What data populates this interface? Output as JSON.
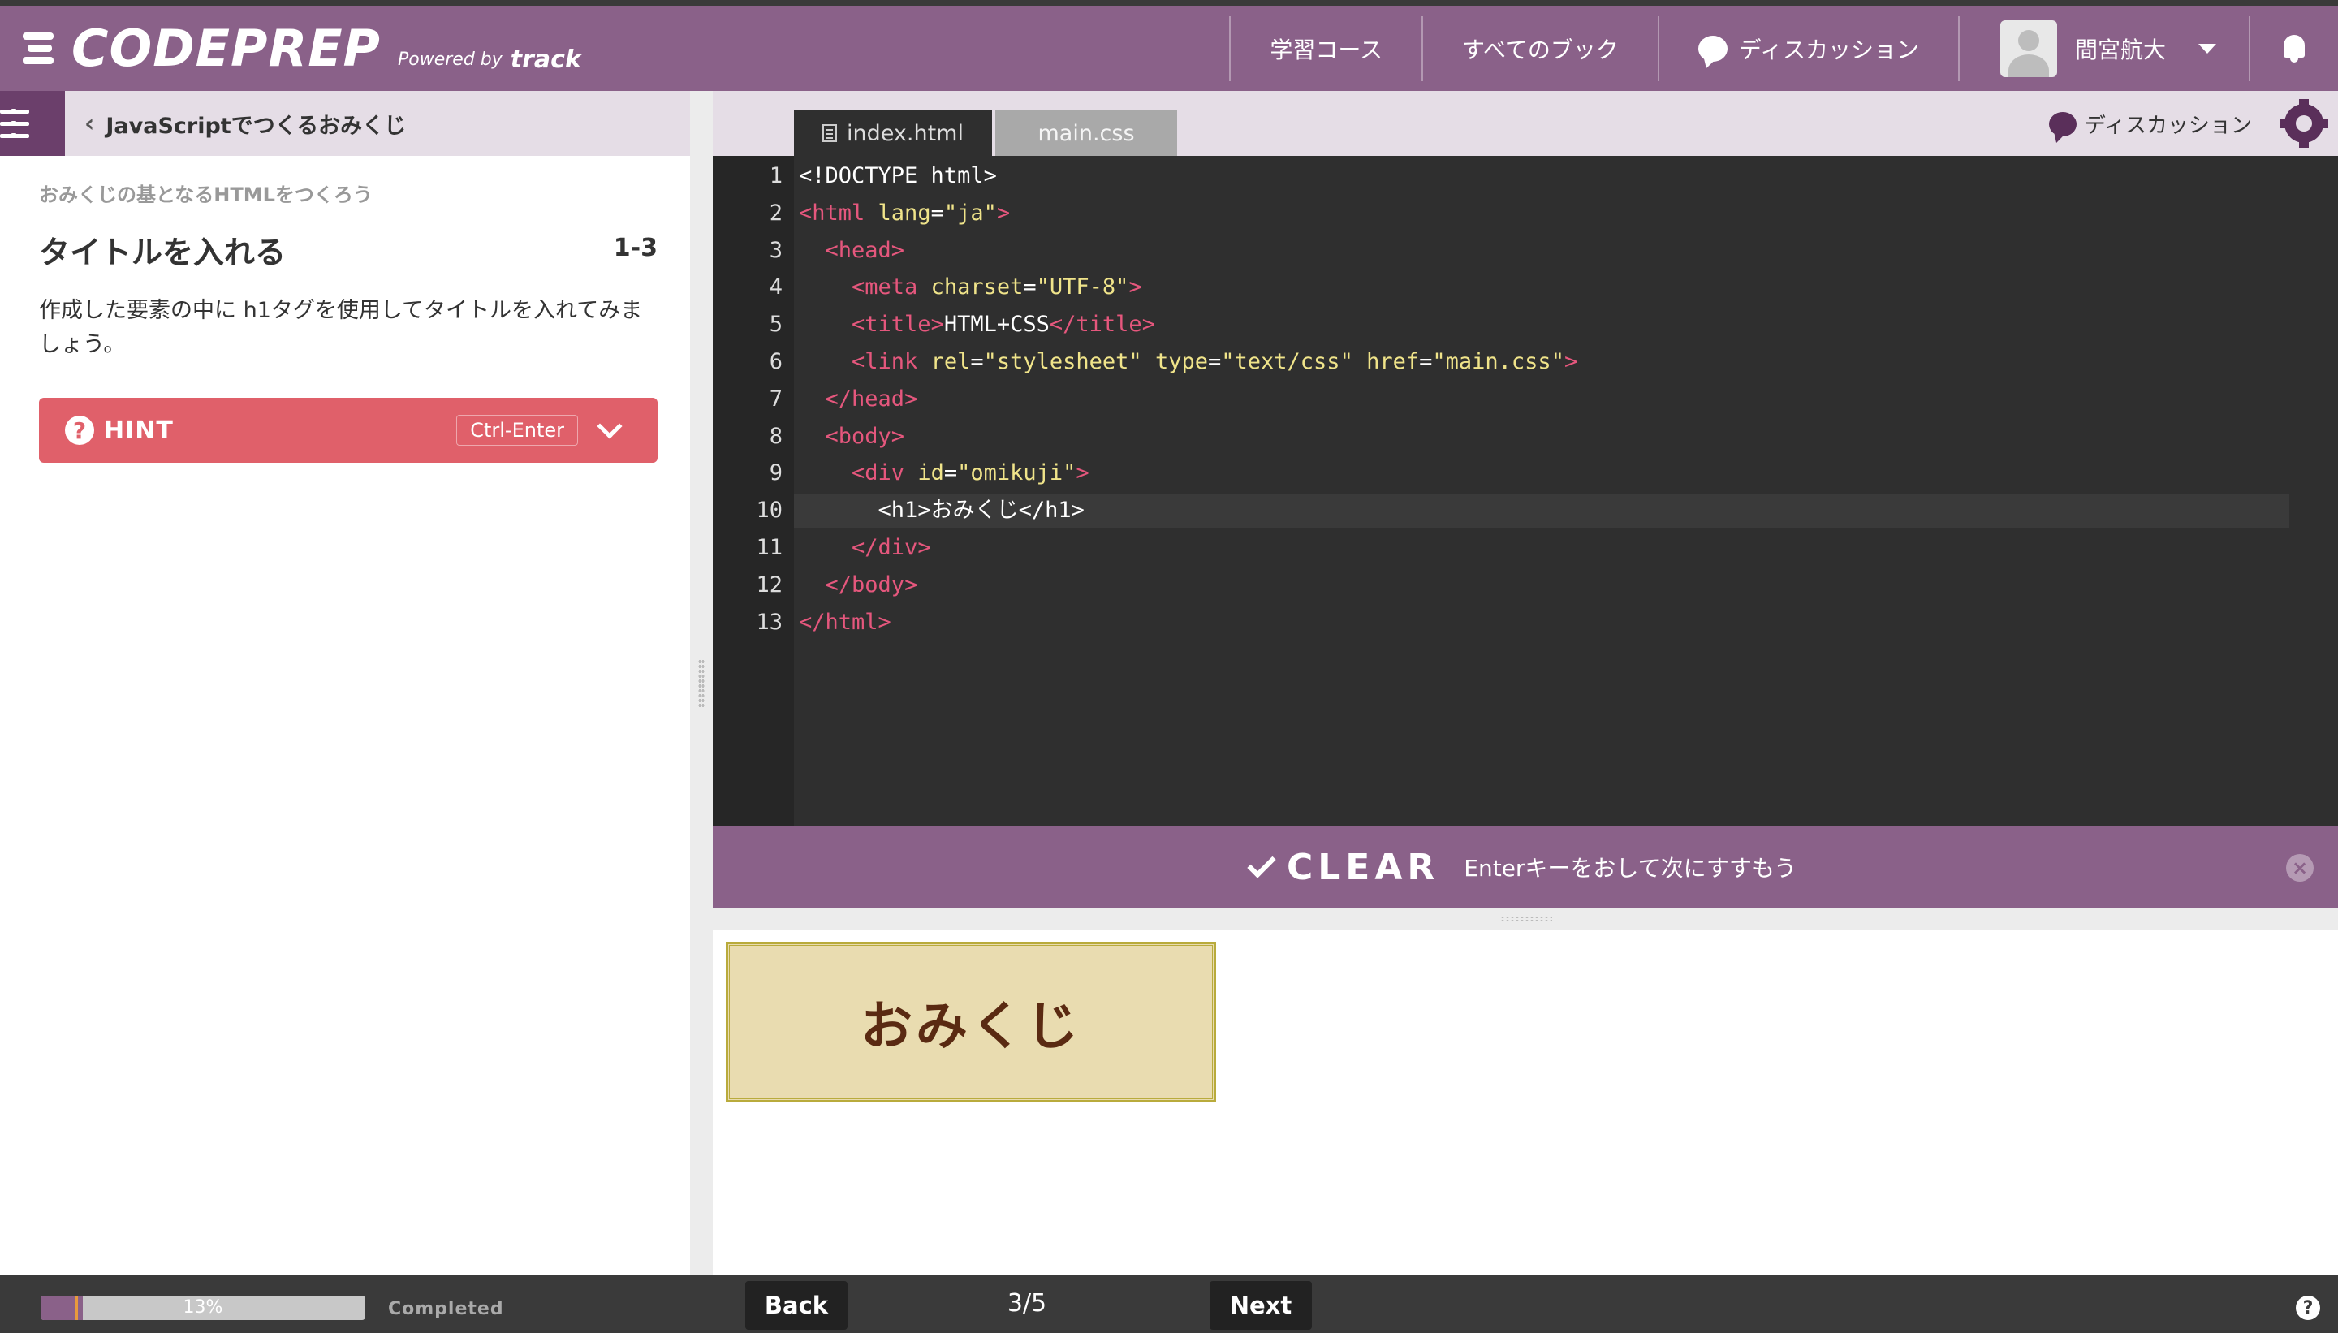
{
  "brand": {
    "logo": "CODEPREP",
    "powered_by": "Powered by",
    "partner": "track"
  },
  "nav": {
    "courses": "学習コース",
    "books": "すべてのブック",
    "discussion": "ディスカッション",
    "user_name": "間宮航大"
  },
  "sidebar": {
    "course_title": "JavaScriptでつくるおみくじ",
    "section": "おみくじの基となるHTMLをつくろう",
    "lesson_title": "タイトルを入れる",
    "lesson_number": "1-3",
    "description": "作成した要素の中に h1タグを使用してタイトルを入れてみましょう。",
    "hint_label": "HINT",
    "hint_shortcut": "Ctrl-Enter"
  },
  "editor": {
    "tabs": [
      {
        "label": "index.html",
        "active": true
      },
      {
        "label": "main.css",
        "active": false
      }
    ],
    "discussion": "ディスカッション",
    "active_line": 10,
    "lines": [
      {
        "n": "1",
        "code": "<!DOCTYPE html>"
      },
      {
        "n": "2",
        "code": "<html lang=\"ja\">"
      },
      {
        "n": "3",
        "code": "  <head>"
      },
      {
        "n": "4",
        "code": "    <meta charset=\"UTF-8\">"
      },
      {
        "n": "5",
        "code": "    <title>HTML+CSS</title>"
      },
      {
        "n": "6",
        "code": "    <link rel=\"stylesheet\" type=\"text/css\" href=\"main.css\">"
      },
      {
        "n": "7",
        "code": "  </head>"
      },
      {
        "n": "8",
        "code": "  <body>"
      },
      {
        "n": "9",
        "code": "    <div id=\"omikuji\">"
      },
      {
        "n": "10",
        "code": "      <h1>おみくじ</h1>"
      },
      {
        "n": "11",
        "code": "    </div>"
      },
      {
        "n": "12",
        "code": "  </body>"
      },
      {
        "n": "13",
        "code": "</html>"
      }
    ]
  },
  "clear": {
    "label": "CLEAR",
    "message": "Enterキーをおして次にすすもう"
  },
  "preview": {
    "heading": "おみくじ"
  },
  "footer": {
    "progress_percent": 13,
    "progress_label": "13%",
    "completed": "Completed",
    "back": "Back",
    "next": "Next",
    "page": "3/5",
    "help": "?"
  },
  "colors": {
    "brand_purple": "#8a6189",
    "hint_red": "#e0606a",
    "editor_bg": "#2f2f2f",
    "tag": "#e5577d",
    "attr": "#f0e48a"
  }
}
